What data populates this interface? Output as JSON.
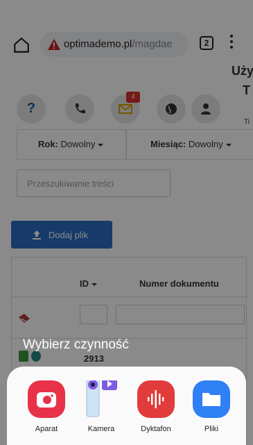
{
  "browser": {
    "url_host": "optimademo.pl",
    "url_path": "/magdae",
    "tab_count": "2"
  },
  "page": {
    "heading_line1": "Uży",
    "heading_line2": "T",
    "heading_line3": "Ti",
    "mail_badge": "4",
    "help_label": "?",
    "filters": {
      "year_label": "Rok:",
      "year_value": "Dowolny",
      "month_label": "Miesiąc:",
      "month_value": "Dowolny"
    },
    "search_placeholder": "Przeszukiwanie treści",
    "upload_button": "Dodaj plik",
    "table": {
      "col_id": "ID",
      "col_doc_number": "Numer dokumentu",
      "first_row_id": "2913"
    }
  },
  "share_sheet": {
    "title": "Wybierz czynność",
    "apps": [
      {
        "label": "Aparat",
        "icon": "camera-app-icon",
        "color": "#e8324a"
      },
      {
        "label": "Kamera",
        "icon": "video-camera-icon",
        "color": "#7e5ce0"
      },
      {
        "label": "Dyktafon",
        "icon": "voice-recorder-icon",
        "color": "#e23b3b"
      },
      {
        "label": "Pliki",
        "icon": "files-folder-icon",
        "color": "#2f7ff5"
      }
    ]
  },
  "colors": {
    "brand_blue": "#2b6cc4",
    "warning_red": "#d9302a"
  }
}
